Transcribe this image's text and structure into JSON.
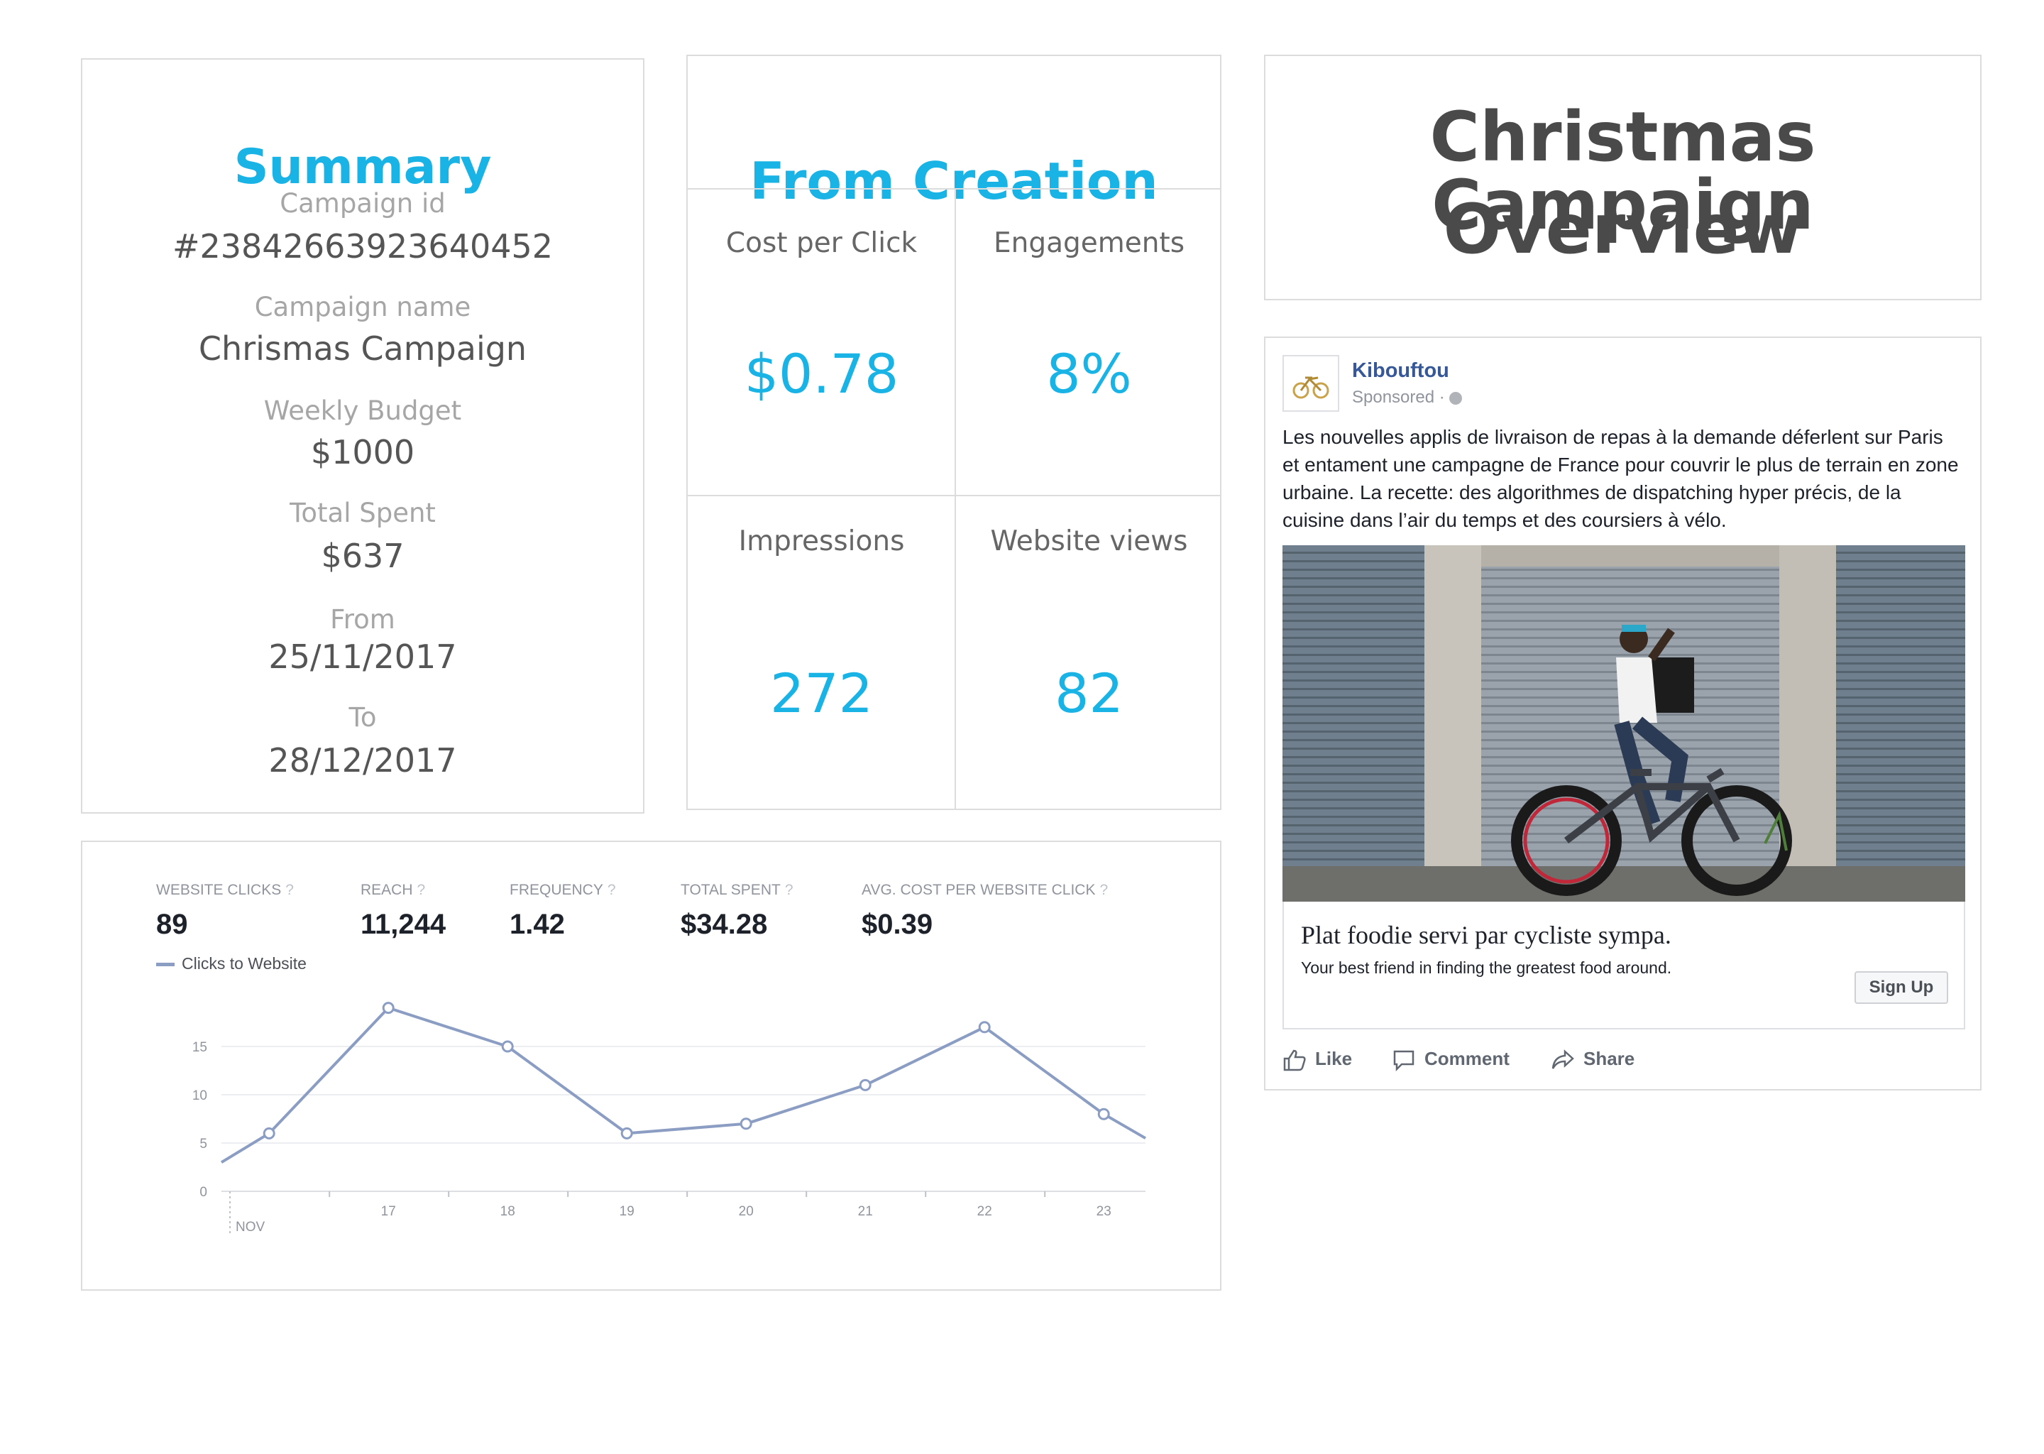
{
  "summary": {
    "title": "Summary",
    "campaign_id_label": "Campaign id",
    "campaign_id": "#23842663923640452",
    "campaign_name_label": "Campaign name",
    "campaign_name": "Chrismas Campaign",
    "weekly_budget_label": "Weekly Budget",
    "weekly_budget": "$1000",
    "total_spent_label": "Total Spent",
    "total_spent": "$637",
    "from_label": "From",
    "from": "25/11/2017",
    "to_label": "To",
    "to": "28/12/2017"
  },
  "creation": {
    "title": "From Creation",
    "metrics": [
      {
        "label": "Cost per Click",
        "value": "$0.78"
      },
      {
        "label": "Engagements",
        "value": "8%"
      },
      {
        "label": "Impressions",
        "value": "272"
      },
      {
        "label": "Website views",
        "value": "82"
      }
    ]
  },
  "overview": {
    "line1": "Christmas Campaign",
    "line2": "Overview"
  },
  "post": {
    "page_name": "Kibouftou",
    "sponsored": "Sponsored ·",
    "body": "Les nouvelles applis de livraison de repas à la demande déferlent sur Paris et entament une campagne de France pour couvrir le plus de terrain en zone urbaine. La recette: des algorithmes de dispatching hyper précis, de la cuisine dans l’air du temps et des coursiers à vélo.",
    "headline": "Plat foodie servi par cycliste sympa.",
    "description": "Your best friend in finding the greatest food around.",
    "cta": "Sign Up",
    "actions": {
      "like": "Like",
      "comment": "Comment",
      "share": "Share"
    },
    "accent_color": "#365899"
  },
  "stats": {
    "items": [
      {
        "label": "WEBSITE CLICKS",
        "value": "89"
      },
      {
        "label": "REACH",
        "value": "11,244"
      },
      {
        "label": "FREQUENCY",
        "value": "1.42"
      },
      {
        "label": "TOTAL SPENT",
        "value": "$34.28"
      },
      {
        "label": "AVG. COST PER WEBSITE CLICK",
        "value": "$0.39"
      }
    ],
    "help": "?",
    "month": "NOV"
  },
  "chart_data": {
    "type": "line",
    "x": [
      15.6,
      16,
      17,
      18,
      19,
      20,
      21,
      22,
      23,
      23.35
    ],
    "series": [
      {
        "name": "Clicks to Website",
        "values": [
          3,
          6,
          19,
          15,
          6,
          7,
          11,
          17,
          8,
          5.5
        ]
      }
    ],
    "marker_indices": [
      1,
      2,
      3,
      4,
      5,
      6,
      7,
      8
    ],
    "xticks": [
      "17",
      "18",
      "19",
      "20",
      "21",
      "22",
      "23"
    ],
    "xtick_values": [
      17,
      18,
      19,
      20,
      21,
      22,
      23
    ],
    "yticks": [
      0,
      5,
      10,
      15
    ],
    "ylim": [
      0,
      20
    ],
    "xlim": [
      15.6,
      23.35
    ],
    "grid": true,
    "line_color": "#8b9dc3"
  }
}
